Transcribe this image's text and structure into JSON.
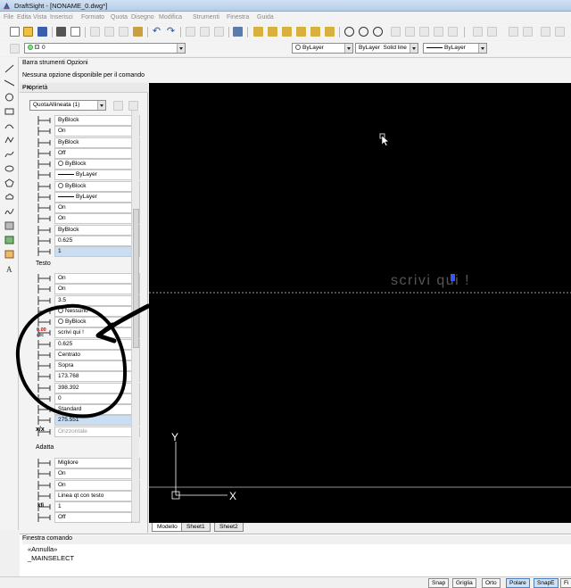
{
  "window": {
    "title": "DraftSight - [NONAME_0.dwg*]"
  },
  "menu": [
    "File",
    "Edita",
    "Vista",
    "Inserisci",
    "Formato",
    "Quota",
    "Disegno",
    "Modifica",
    "Strumenti",
    "Finestra",
    "Guida"
  ],
  "toolbar": {
    "layer_value": "0",
    "color_value": "ByLayer",
    "linestyle_value": "ByLayer",
    "linestyle_name": "Solid line",
    "lineweight_value": "ByLayer"
  },
  "options_bar": {
    "title": "Barra strumenti Opzioni",
    "message": "Nessuna opzione disponibile per il comando"
  },
  "properties": {
    "title": "Proprietà",
    "selection": "QuotaAllineata (1)",
    "rows_top": [
      {
        "value": "ByBlock",
        "combo": true
      },
      {
        "value": "On",
        "combo": true
      },
      {
        "value": "ByBlock",
        "combo": true
      },
      {
        "value": "Off",
        "combo": true
      },
      {
        "value": "ByBlock",
        "combo": true,
        "circle": true
      },
      {
        "value": "ByLayer",
        "combo": true,
        "line": true
      },
      {
        "value": "ByBlock",
        "combo": true,
        "circle": true
      },
      {
        "value": "ByLayer",
        "combo": true,
        "line": true
      },
      {
        "value": "On",
        "combo": true
      },
      {
        "value": "On",
        "combo": true
      },
      {
        "value": "ByBlock",
        "combo": true
      },
      {
        "value": "0.625",
        "combo": false
      },
      {
        "value": "1",
        "combo": false,
        "highlight": true
      }
    ],
    "section_text": "Testo",
    "rows_text": [
      {
        "value": "On",
        "combo": true
      },
      {
        "value": "On",
        "combo": true
      },
      {
        "value": "3.5",
        "combo": false
      },
      {
        "value": "Nessuno",
        "combo": true,
        "circle": true
      },
      {
        "value": "ByBlock",
        "combo": true,
        "circle": true
      },
      {
        "value": "scrivi qui !",
        "combo": false
      },
      {
        "value": "0.625",
        "combo": false
      },
      {
        "value": "Centrato",
        "combo": true
      },
      {
        "value": "Sopra",
        "combo": true
      },
      {
        "value": "173.768",
        "combo": false
      },
      {
        "value": "398.392",
        "combo": false
      },
      {
        "value": "0",
        "combo": false
      },
      {
        "value": "Standard",
        "combo": true
      },
      {
        "value": "275.551",
        "combo": false,
        "highlight": true
      },
      {
        "value": "Orizzontale",
        "combo": true,
        "disabled": true
      }
    ],
    "section_fit": "Adatta",
    "rows_fit": [
      {
        "value": "Migliore",
        "combo": true
      },
      {
        "value": "On",
        "combo": true
      },
      {
        "value": "On",
        "combo": true
      },
      {
        "value": "Linea qt con testo",
        "combo": true
      },
      {
        "value": "1",
        "combo": false
      },
      {
        "value": "Off",
        "combo": true
      }
    ],
    "icon_labels": {
      "rot": "0.00",
      "abc": "abc",
      "xy": "x/x",
      "xfit": "xfi"
    }
  },
  "canvas": {
    "text": "scrivi qui !",
    "axis_x": "X",
    "axis_y": "Y",
    "background": "#000000"
  },
  "tabs": [
    "Modello",
    "Sheet1",
    "Sheet2"
  ],
  "command": {
    "title": "Finestra comando",
    "line1": "«Annulla»",
    "line2": "_MAINSELECT"
  },
  "status": {
    "buttons": [
      {
        "label": "Snap",
        "on": false
      },
      {
        "label": "Griglia",
        "on": false
      },
      {
        "label": "Orto",
        "on": false
      },
      {
        "label": "Polare",
        "on": true
      },
      {
        "label": "SnapE",
        "on": true
      },
      {
        "label": "Fi",
        "on": false
      }
    ]
  },
  "colors": {
    "accent": "#4a7fc0",
    "highlight": "#c9ddf3",
    "canvas": "#000000"
  }
}
